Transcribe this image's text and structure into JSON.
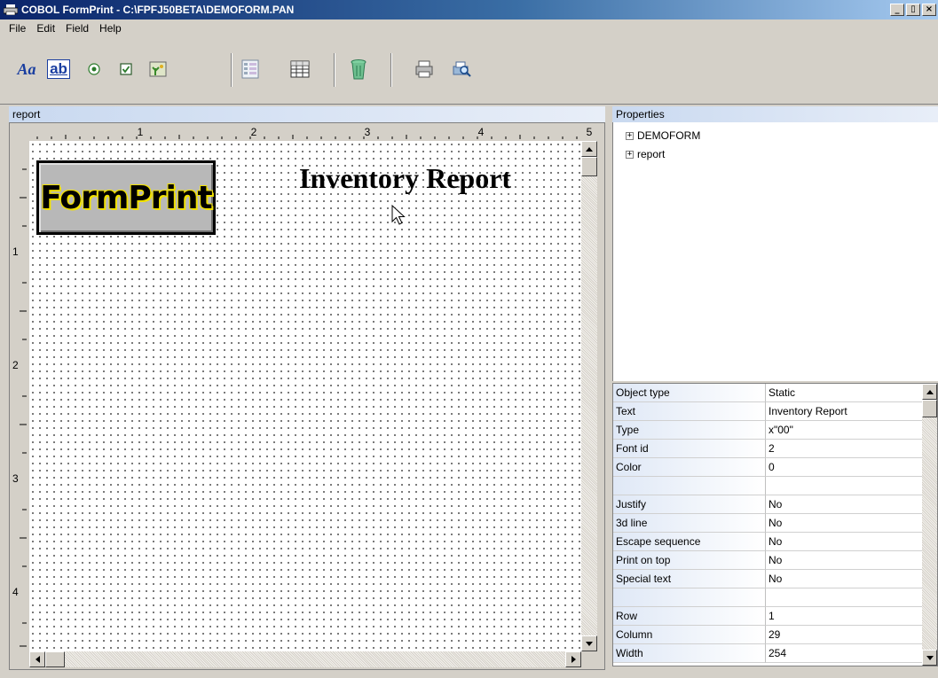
{
  "window": {
    "title": "COBOL FormPrint - C:\\FPFJ50BETA\\DEMOFORM.PAN",
    "controls": {
      "minimize": "_",
      "restore": "▯",
      "close": "×"
    }
  },
  "menu": [
    "File",
    "Edit",
    "Field",
    "Help"
  ],
  "toolbar": {
    "text_tool_label": "Aa",
    "edit_tool_label": "ab"
  },
  "left_panel": {
    "title": "report",
    "ruler_h_labels": [
      "1",
      "2",
      "3",
      "4",
      "5"
    ],
    "ruler_v_labels": [
      "1",
      "2",
      "3",
      "4"
    ],
    "logo_text": "FormPrint",
    "report_title": "Inventory Report"
  },
  "right_panel": {
    "title": "Properties",
    "tree": [
      {
        "label": "DEMOFORM",
        "expander": "+"
      },
      {
        "label": "report",
        "expander": "+"
      }
    ],
    "properties": [
      {
        "name": "Object type",
        "value": "Static"
      },
      {
        "name": "Text",
        "value": "Inventory Report"
      },
      {
        "name": "Type",
        "value": "x\"00\""
      },
      {
        "name": "Font id",
        "value": "2"
      },
      {
        "name": "Color",
        "value": "0"
      },
      {
        "name": "",
        "value": ""
      },
      {
        "name": "Justify",
        "value": "No"
      },
      {
        "name": "3d line",
        "value": "No"
      },
      {
        "name": "Escape sequence",
        "value": "No"
      },
      {
        "name": "Print on top",
        "value": "No"
      },
      {
        "name": "Special text",
        "value": "No"
      },
      {
        "name": "",
        "value": ""
      },
      {
        "name": "Row",
        "value": "1"
      },
      {
        "name": "Column",
        "value": "29"
      },
      {
        "name": "Width",
        "value": "254"
      }
    ]
  },
  "colors": {
    "title_bar_start": "#0a246a",
    "title_bar_end": "#a6caf0",
    "logo_outline": "#f0e000"
  }
}
